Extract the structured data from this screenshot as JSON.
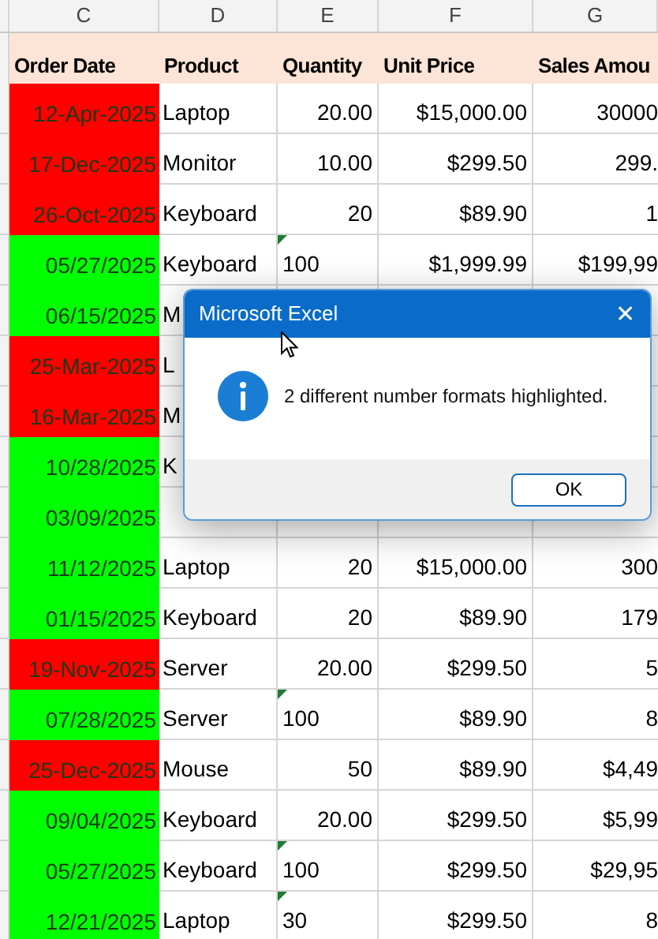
{
  "columns": [
    "C",
    "D",
    "E",
    "F",
    "G"
  ],
  "headers": [
    "Order Date",
    "Product",
    "Quantity",
    "Unit Price",
    "Sales Amou"
  ],
  "rows": [
    {
      "date": "12-Apr-2025",
      "color": "#ff0000",
      "product": "Laptop",
      "quantity": "20.00",
      "qty_as_text": false,
      "price": "$15,000.00",
      "sales": "30000"
    },
    {
      "date": "17-Dec-2025",
      "color": "#ff0000",
      "product": "Monitor",
      "quantity": "10.00",
      "qty_as_text": false,
      "price": "$299.50",
      "sales": "299."
    },
    {
      "date": "26-Oct-2025",
      "color": "#ff0000",
      "product": "Keyboard",
      "quantity": "20",
      "qty_as_text": false,
      "price": "$89.90",
      "sales": "1"
    },
    {
      "date": "05/27/2025",
      "color": "#00ff00",
      "product": "Keyboard",
      "quantity": "100",
      "qty_as_text": true,
      "price": "$1,999.99",
      "sales": "$199,99"
    },
    {
      "date": "06/15/2025",
      "color": "#00ff00",
      "product": "M"
    },
    {
      "date": "25-Mar-2025",
      "color": "#ff0000",
      "product": "L"
    },
    {
      "date": "16-Mar-2025",
      "color": "#ff0000",
      "product": "M"
    },
    {
      "date": "10/28/2025",
      "color": "#00ff00",
      "product": "K"
    },
    {
      "date": "03/09/2025",
      "color": "#00ff00"
    },
    {
      "date": "11/12/2025",
      "color": "#00ff00",
      "product": "Laptop",
      "quantity": "20",
      "qty_as_text": false,
      "price": "$15,000.00",
      "sales": "300"
    },
    {
      "date": "01/15/2025",
      "color": "#00ff00",
      "product": "Keyboard",
      "quantity": "20",
      "qty_as_text": false,
      "price": "$89.90",
      "sales": "179"
    },
    {
      "date": "19-Nov-2025",
      "color": "#ff0000",
      "product": "Server",
      "quantity": "20.00",
      "qty_as_text": false,
      "price": "$299.50",
      "sales": "5"
    },
    {
      "date": "07/28/2025",
      "color": "#00ff00",
      "product": "Server",
      "quantity": "100",
      "qty_as_text": true,
      "price": "$89.90",
      "sales": "8"
    },
    {
      "date": "25-Dec-2025",
      "color": "#ff0000",
      "product": "Mouse",
      "quantity": "50",
      "qty_as_text": false,
      "price": "$89.90",
      "sales": "$4,49"
    },
    {
      "date": "09/04/2025",
      "color": "#00ff00",
      "product": "Keyboard",
      "quantity": "20.00",
      "qty_as_text": false,
      "price": "$299.50",
      "sales": "$5,99"
    },
    {
      "date": "05/27/2025",
      "color": "#00ff00",
      "product": "Keyboard",
      "quantity": "100",
      "qty_as_text": true,
      "price": "$299.50",
      "sales": "$29,95"
    },
    {
      "date": "12/21/2025",
      "color": "#00ff00",
      "product": "Laptop",
      "quantity": "30",
      "qty_as_text": true,
      "price": "$299.50",
      "sales": "8"
    }
  ],
  "dialog": {
    "title": "Microsoft Excel",
    "close": "✕",
    "message": "2 different number formats highlighted.",
    "button": "OK"
  }
}
